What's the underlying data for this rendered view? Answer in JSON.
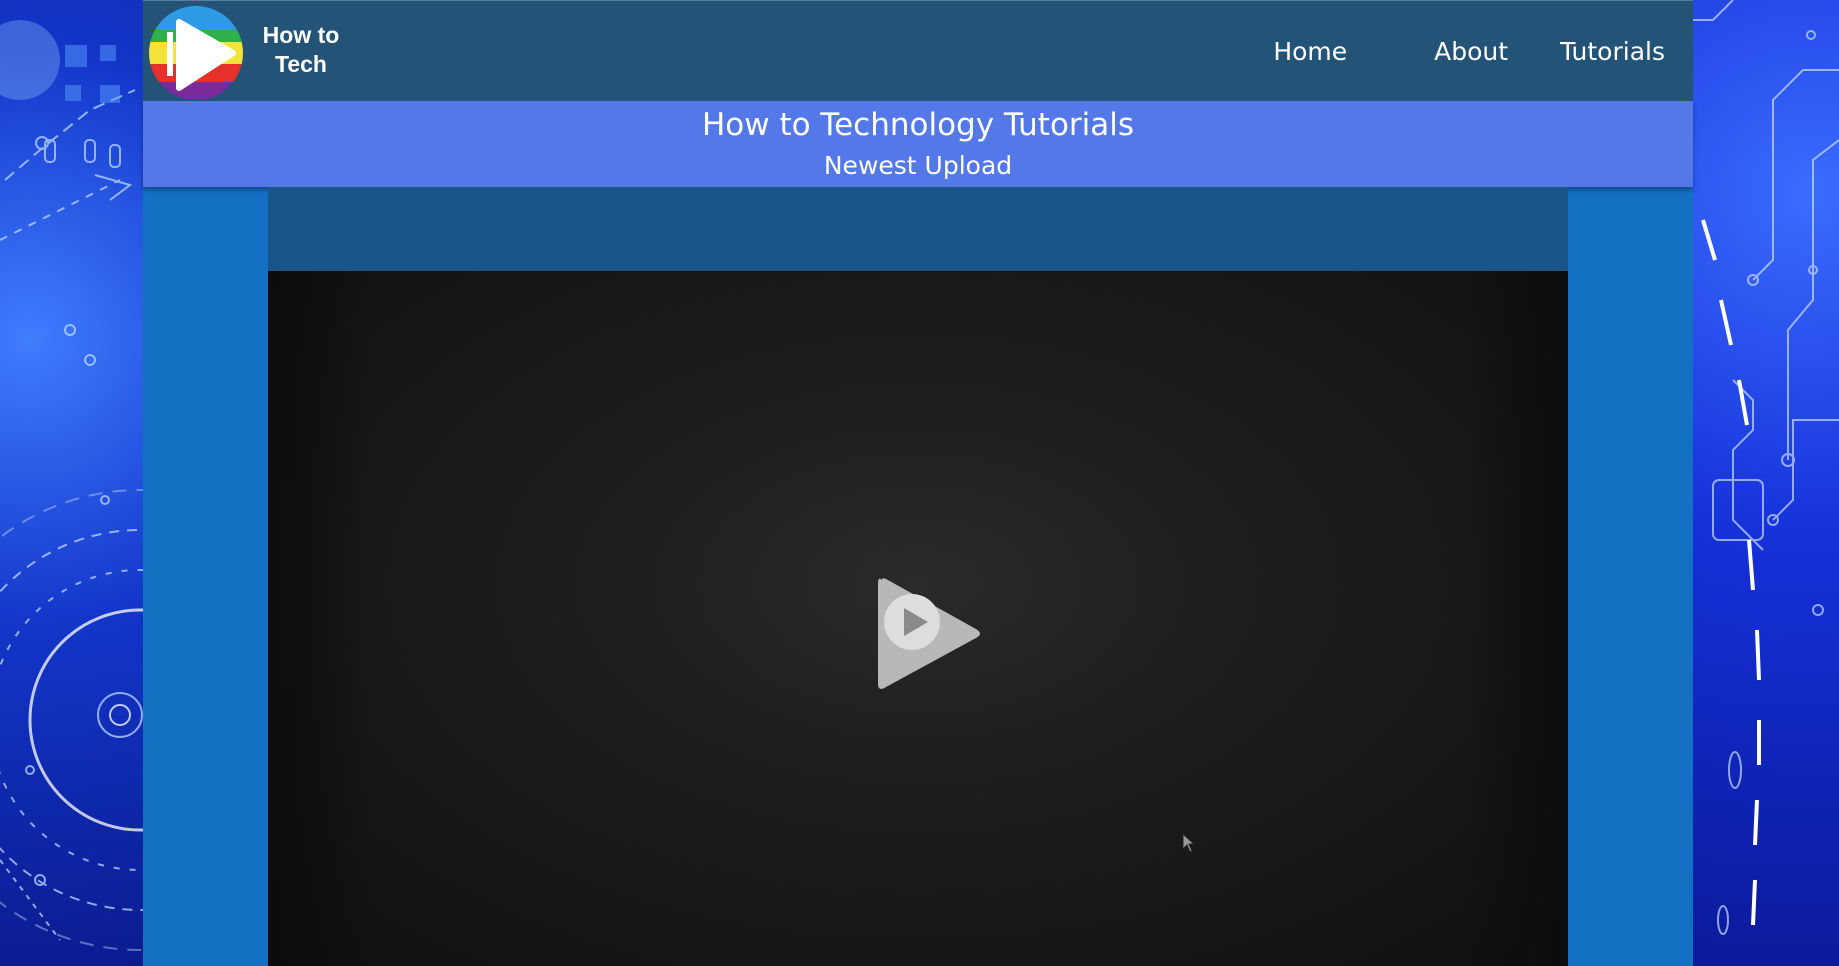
{
  "brand": {
    "name_line1": "How to",
    "name_line2": "Tech",
    "logo_icon": "play-logo-icon",
    "logo_colors": [
      "#2f9be6",
      "#2fb04b",
      "#f3e43a",
      "#e8302a",
      "#7a2a9a"
    ]
  },
  "nav": {
    "items": [
      {
        "label": "Home"
      },
      {
        "label": "About"
      },
      {
        "label": "Tutorials"
      }
    ]
  },
  "hero": {
    "title": "How to Technology Tutorials",
    "subtitle": "Newest Upload"
  },
  "video": {
    "play_icon": "play-icon",
    "cursor_icon": "mouse-cursor-icon"
  },
  "colors": {
    "navbar": "#235377",
    "hero": "#5478e8",
    "page": "#1470c2",
    "video_header": "#1b5489",
    "video_bg": "#1c1c1c"
  }
}
